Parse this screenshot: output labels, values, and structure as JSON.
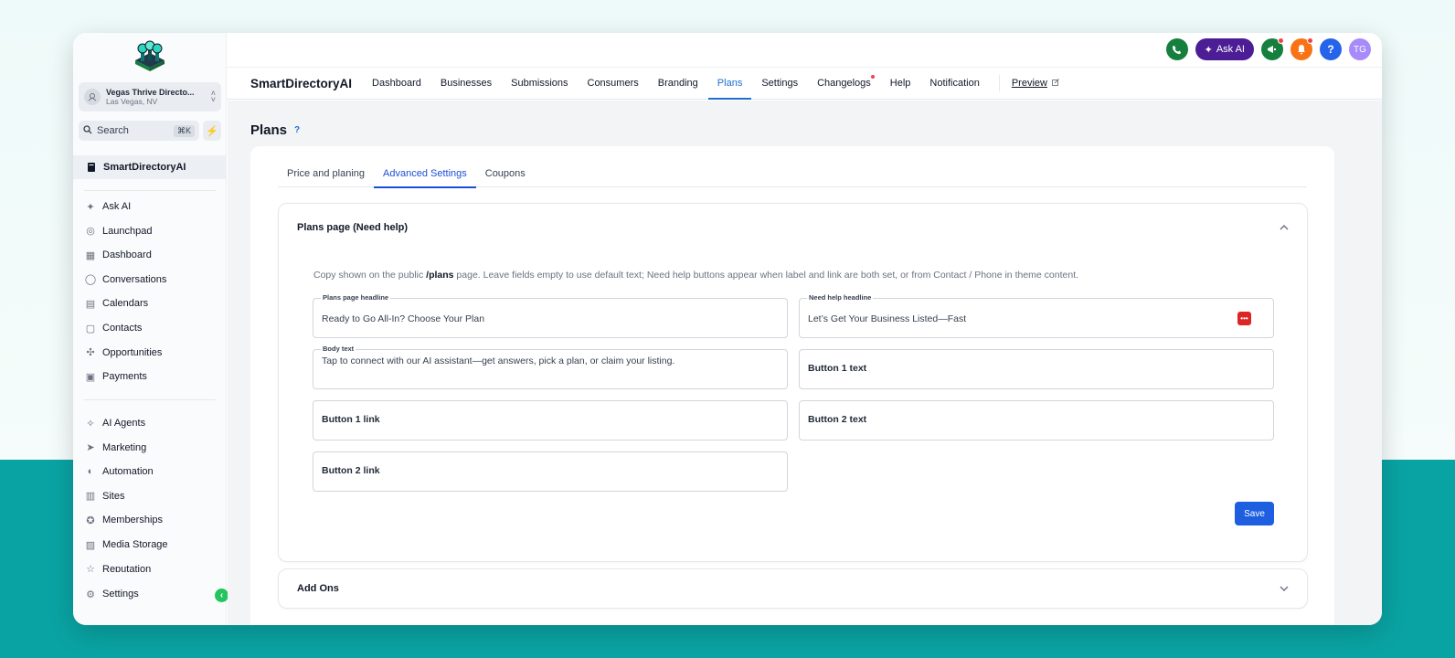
{
  "app": {
    "name": "SmartDirectoryAI",
    "location": {
      "name": "Vegas Thrive Directo...",
      "city": "Las Vegas, NV"
    }
  },
  "sidebar": {
    "search": {
      "placeholder": "Search",
      "shortcut": "⌘K"
    },
    "workspace_item": "SmartDirectoryAI",
    "items_a": [
      {
        "label": "Ask AI",
        "icon": "sparkle-icon"
      },
      {
        "label": "Launchpad",
        "icon": "rocket-icon"
      },
      {
        "label": "Dashboard",
        "icon": "grid-icon"
      },
      {
        "label": "Conversations",
        "icon": "chat-icon"
      },
      {
        "label": "Calendars",
        "icon": "calendar-icon"
      },
      {
        "label": "Contacts",
        "icon": "contacts-icon"
      },
      {
        "label": "Opportunities",
        "icon": "opportunities-icon"
      },
      {
        "label": "Payments",
        "icon": "payments-icon"
      }
    ],
    "items_b": [
      {
        "label": "AI Agents",
        "icon": "ai-agents-icon"
      },
      {
        "label": "Marketing",
        "icon": "send-icon"
      },
      {
        "label": "Automation",
        "icon": "automation-icon"
      },
      {
        "label": "Sites",
        "icon": "sites-icon"
      },
      {
        "label": "Memberships",
        "icon": "badge-icon"
      },
      {
        "label": "Media Storage",
        "icon": "image-icon"
      },
      {
        "label": "Reputation",
        "icon": "star-icon"
      }
    ],
    "settings": "Settings"
  },
  "topbar": {
    "ask_ai": "Ask AI",
    "avatar_initials": "TG",
    "help": "?"
  },
  "navbar": {
    "brand": "SmartDirectoryAI",
    "tabs": [
      "Dashboard",
      "Businesses",
      "Submissions",
      "Consumers",
      "Branding",
      "Plans",
      "Settings",
      "Changelogs",
      "Help",
      "Notification"
    ],
    "active_tab": "Plans",
    "preview": "Preview"
  },
  "page": {
    "title": "Plans",
    "help": "?",
    "tabs": [
      "Price and planing",
      "Advanced Settings",
      "Coupons"
    ],
    "active_tab": "Advanced Settings",
    "section1": {
      "title": "Plans page (Need help)",
      "desc_pre": "Copy shown on the public ",
      "desc_bold": "/plans",
      "desc_post": " page. Leave fields empty to use default text; Need help buttons appear when label and link are both set, or from Contact / Phone in theme content.",
      "fields": {
        "plans_headline": {
          "label": "Plans page headline",
          "value": "Ready to Go All-In? Choose Your Plan"
        },
        "need_help_headline": {
          "label": "Need help headline",
          "value": "Let’s Get Your Business Listed—Fast"
        },
        "body_text": {
          "label": "Body text",
          "value": "Tap to connect with our AI assistant—get answers, pick a plan, or claim your listing."
        },
        "button1_text": {
          "placeholder": "Button 1 text"
        },
        "button1_link": {
          "placeholder": "Button 1 link"
        },
        "button2_text": {
          "placeholder": "Button 2 text"
        },
        "button2_link": {
          "placeholder": "Button 2 link"
        }
      },
      "save": "Save"
    },
    "section2": {
      "title": "Add Ons"
    }
  },
  "colors": {
    "accent": "#1d6fd1",
    "save_button": "#1d5fe0",
    "ask_ai": "#4c1d95",
    "phone": "#15803d",
    "bell": "#f97316",
    "help": "#2563eb",
    "avatar": "#a78bfa",
    "backdrop_teal": "#0aa3a3"
  }
}
